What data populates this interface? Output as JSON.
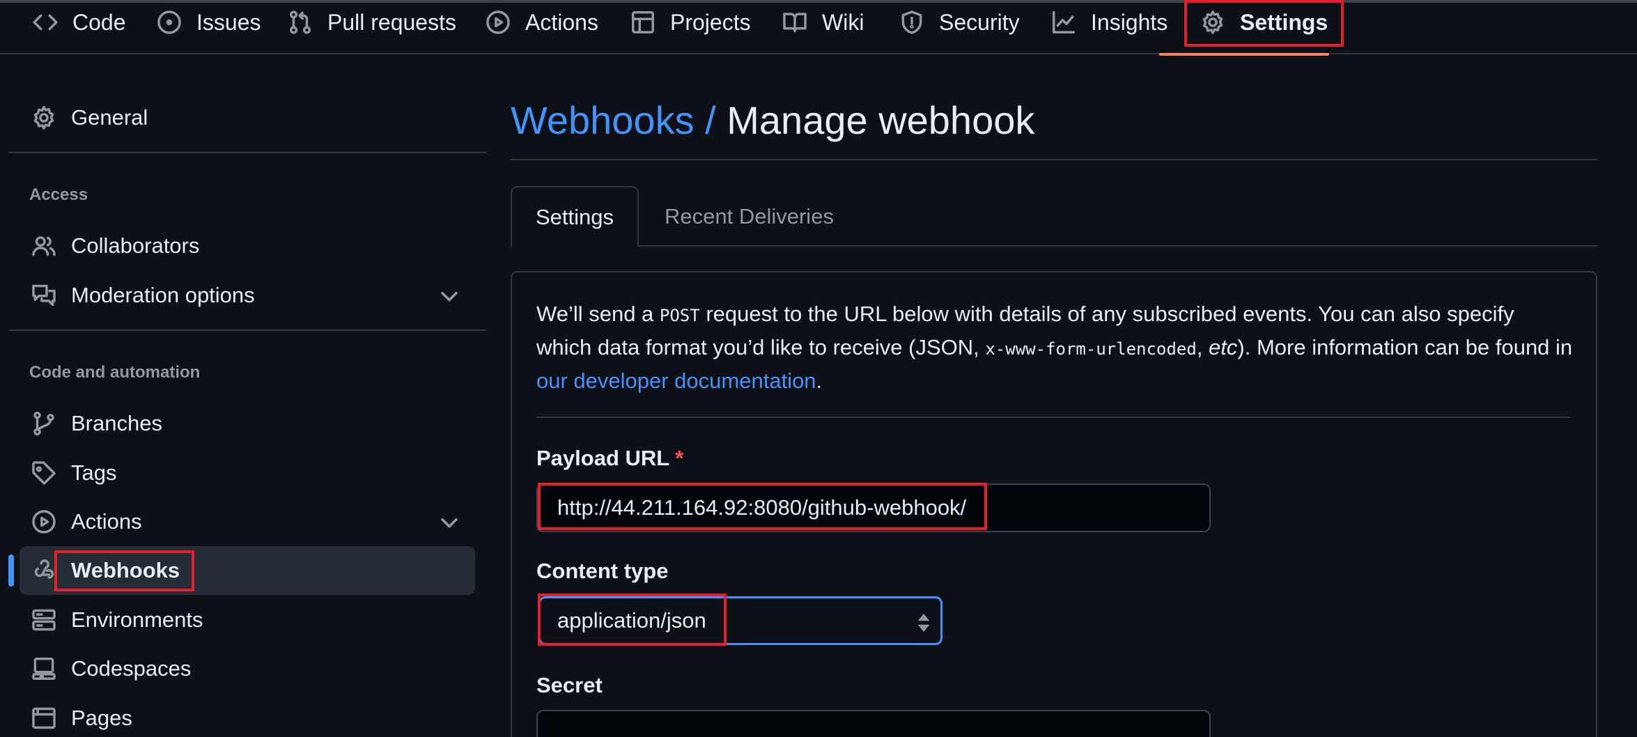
{
  "repo_nav": {
    "tabs": [
      {
        "label": "Code",
        "icon": "code-icon"
      },
      {
        "label": "Issues",
        "icon": "issue-opened-icon"
      },
      {
        "label": "Pull requests",
        "icon": "git-pull-request-icon"
      },
      {
        "label": "Actions",
        "icon": "play-icon"
      },
      {
        "label": "Projects",
        "icon": "table-icon"
      },
      {
        "label": "Wiki",
        "icon": "book-icon"
      },
      {
        "label": "Security",
        "icon": "shield-icon"
      },
      {
        "label": "Insights",
        "icon": "graph-icon"
      },
      {
        "label": "Settings",
        "icon": "gear-icon",
        "selected": true
      }
    ]
  },
  "sidebar": {
    "general": "General",
    "access_heading": "Access",
    "collaborators": "Collaborators",
    "moderation": "Moderation options",
    "code_heading": "Code and automation",
    "branches": "Branches",
    "tags": "Tags",
    "actions": "Actions",
    "webhooks": "Webhooks",
    "environments": "Environments",
    "codespaces": "Codespaces",
    "pages": "Pages"
  },
  "main": {
    "breadcrumb_link": "Webhooks",
    "breadcrumb_sep": " / ",
    "breadcrumb_current": "Manage webhook",
    "tabs": [
      "Settings",
      "Recent Deliveries"
    ],
    "description": {
      "part1": "We’ll send a ",
      "post": "POST",
      "part2": " request to the URL below with details of any subscribed events. You can also specify which data format you’d like to receive (JSON, ",
      "urlencoded": "x-www-form-urlencoded",
      "part3": ", ",
      "etc": "etc",
      "part4": "). More information can be found in ",
      "link": "our developer documentation",
      "end": "."
    },
    "payload_label": "Payload URL",
    "required_mark": "*",
    "payload_value": "http://44.211.164.92:8080/github-webhook/",
    "content_type_label": "Content type",
    "content_type_value": "application/json",
    "secret_label": "Secret"
  },
  "colors": {
    "background": "#0d1117",
    "accent_blue": "#4493f8",
    "tab_underline": "#f78166",
    "highlight_red": "#e5202e"
  }
}
